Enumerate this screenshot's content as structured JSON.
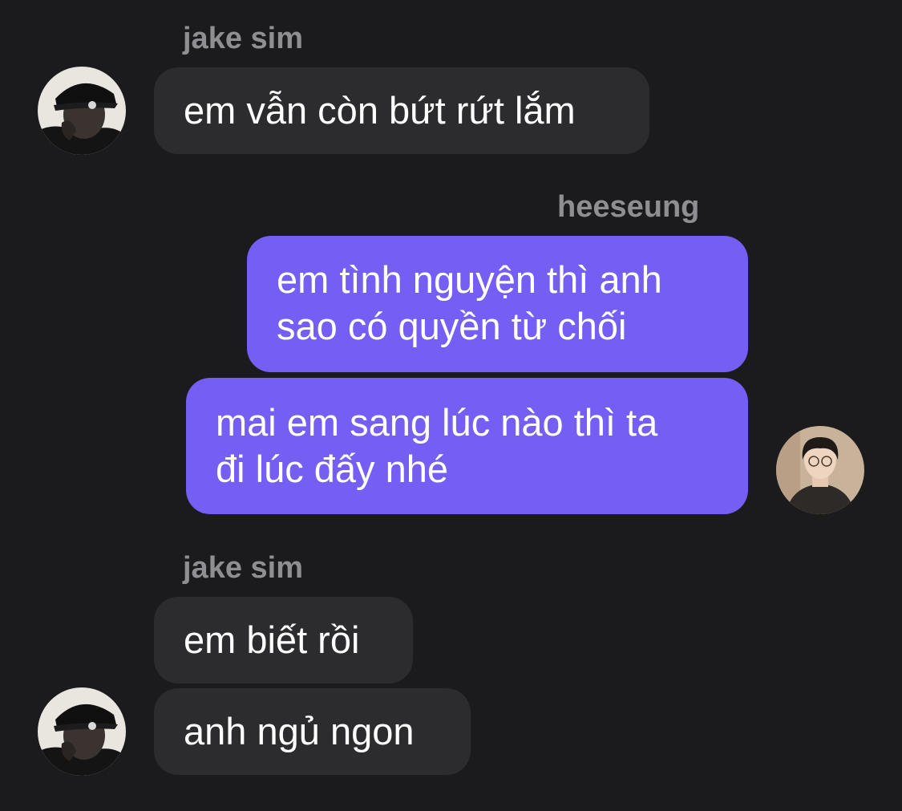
{
  "messages": [
    {
      "sender": "jake sim",
      "text": "em vẫn còn bứt rứt lắm"
    },
    {
      "sender": "heeseung",
      "lines": [
        "em tình nguyện thì anh",
        "sao có quyền từ chối"
      ]
    },
    {
      "sender": "heeseung",
      "lines": [
        "mai em sang lúc nào thì ta",
        "đi lúc đấy nhé"
      ]
    },
    {
      "sender": "jake sim",
      "text": "em biết rồi"
    },
    {
      "sender": "jake sim",
      "text": "anh ngủ ngon"
    }
  ],
  "colors": {
    "background": "#1b1b1d",
    "incoming_bubble": "#2c2c2e",
    "outgoing_bubble": "#745ef4",
    "sender_name": "#8e8e93"
  },
  "icons": [
    "jake-sim-avatar",
    "heeseung-avatar"
  ]
}
